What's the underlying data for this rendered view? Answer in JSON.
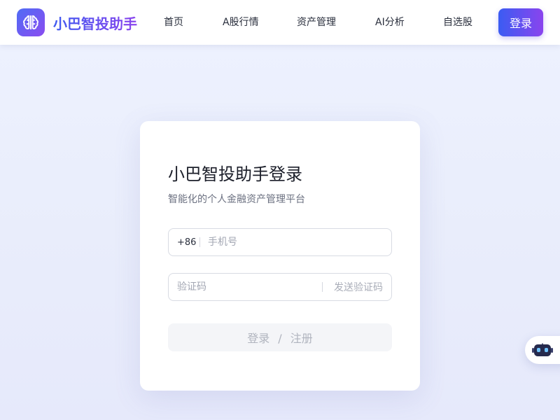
{
  "header": {
    "brand_name": "小巴智投助手",
    "logo_icon": "brain-icon",
    "nav": [
      {
        "label": "首页"
      },
      {
        "label": "A股行情"
      },
      {
        "label": "资产管理"
      },
      {
        "label": "AI分析"
      },
      {
        "label": "自选股"
      }
    ],
    "login_label": "登录"
  },
  "login_card": {
    "title": "小巴智投助手登录",
    "subtitle": "智能化的个人金融资产管理平台",
    "phone": {
      "prefix": "+86",
      "placeholder": "手机号",
      "value": ""
    },
    "code": {
      "placeholder": "验证码",
      "value": "",
      "send_label": "发送验证码"
    },
    "submit": {
      "login": "登录",
      "separator": "/",
      "register": "注册"
    }
  },
  "assistant": {
    "icon": "robot-icon"
  },
  "colors": {
    "accent_start": "#3b5cf2",
    "accent_end": "#8a44ee",
    "background": "#eef2ff"
  }
}
